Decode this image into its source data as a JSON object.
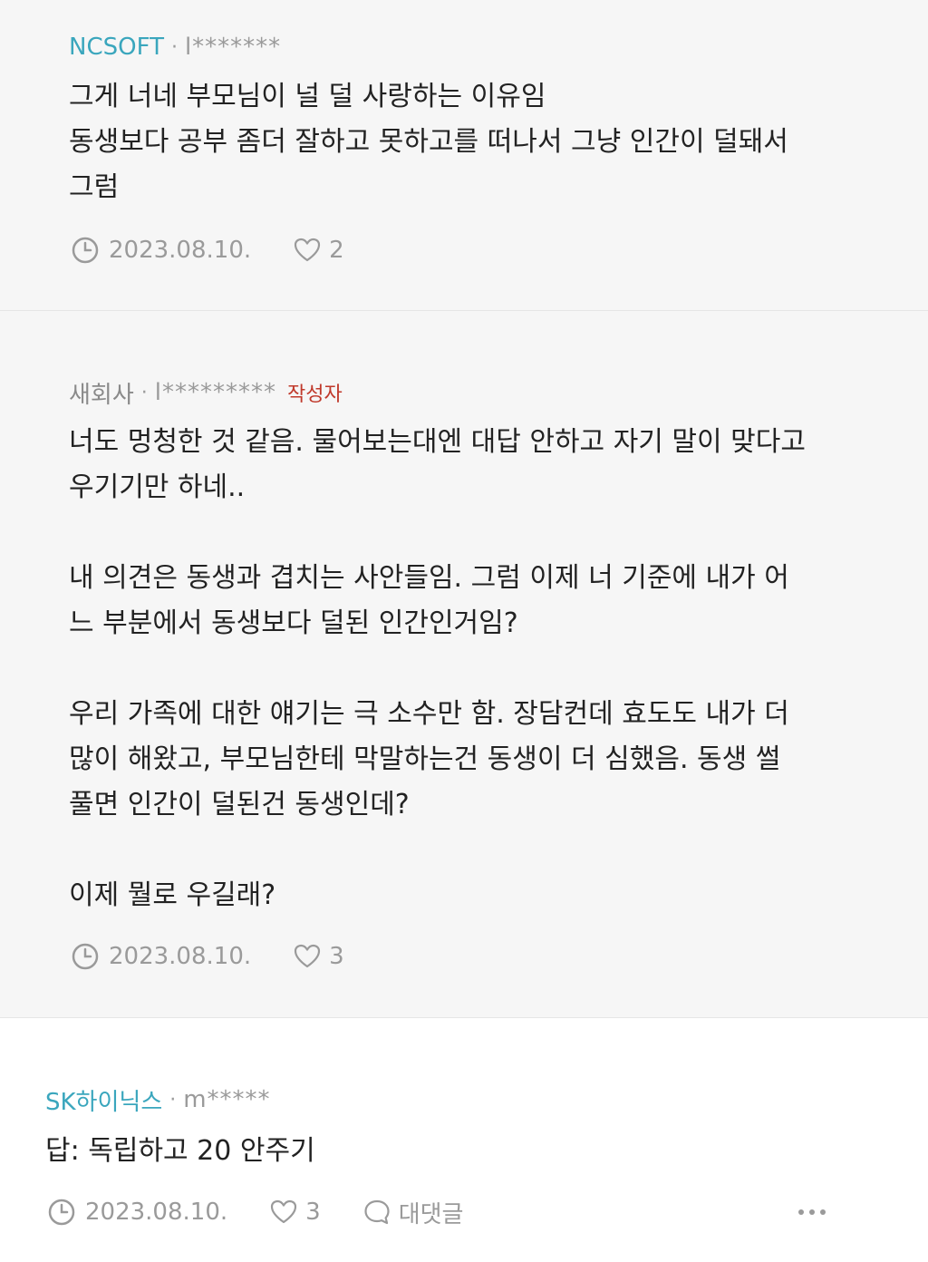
{
  "comments": [
    {
      "company": "NCSOFT",
      "separator": "·",
      "user": "l*******",
      "text": "그게 너네 부모님이 널 덜 사랑하는 이유임\n동생보다 공부 좀더 잘하고 못하고를 떠나서 그냥 인간이 덜돼서\n그럼",
      "date": "2023.08.10.",
      "likes": "2"
    },
    {
      "company": "새회사",
      "separator": "·",
      "user": "l*********",
      "author_badge": "작성자",
      "text": "너도 멍청한 것 같음. 물어보는대엔 대답 안하고 자기 말이 맞다고\n우기기만 하네..\n\n내 의견은 동생과 겹치는 사안들임. 그럼 이제 너 기준에 내가 어\n느 부분에서 동생보다 덜된 인간인거임?\n\n우리 가족에 대한 얘기는 극 소수만 함. 장담컨데 효도도 내가 더\n많이 해왔고, 부모님한테 막말하는건 동생이 더 심했음. 동생 썰\n풀면 인간이 덜된건 동생인데?\n\n이제 뭘로 우길래?",
      "date": "2023.08.10.",
      "likes": "3"
    },
    {
      "company": "SK하이닉스",
      "separator": "·",
      "user": "m*****",
      "text": "답: 독립하고 20 안주기",
      "date": "2023.08.10.",
      "likes": "3",
      "reply_label": "대댓글"
    }
  ],
  "icons": {
    "clock": "clock-icon",
    "heart": "heart-icon",
    "speech": "speech-bubble-icon",
    "more": "more-dots-icon"
  },
  "colors": {
    "company_link": "#3aa6bd",
    "author_badge": "#c0392b",
    "reply_background": "#f6f6f6",
    "meta_grey": "#9a9a9a"
  }
}
